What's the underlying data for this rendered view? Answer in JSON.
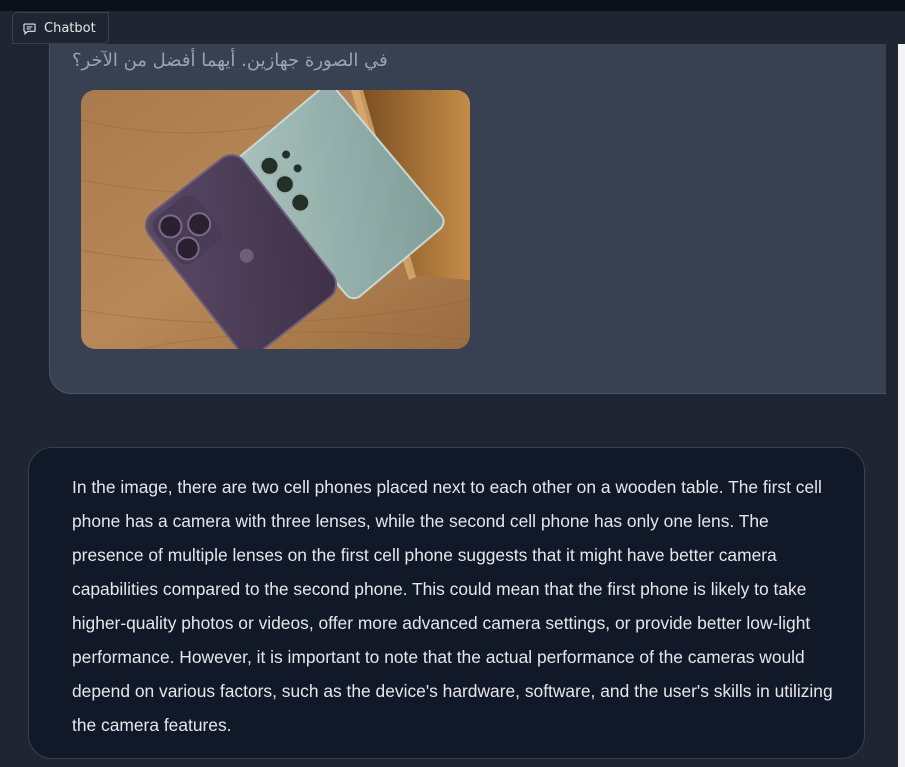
{
  "header": {
    "label": "Chatbot",
    "icon": "chat-bubble-icon"
  },
  "messages": [
    {
      "role": "user",
      "text": "في الصورة جهازين. أيهما أفضل من الآخر؟",
      "image": "two-smartphones-on-wooden-table"
    },
    {
      "role": "bot",
      "text": "In the image, there are two cell phones placed next to each other on a wooden table. The first cell phone has a camera with three lenses, while the second cell phone has only one lens. The presence of multiple lenses on the first cell phone suggests that it might have better camera capabilities compared to the second phone. This could mean that the first phone is likely to take higher-quality photos or videos, offer more advanced camera settings, or provide better low-light performance. However, it is important to note that the actual performance of the cameras would depend on various factors, such as the device's hardware, software, and the user's skills in utilizing the camera features."
    }
  ],
  "colors": {
    "background": "#1f2532",
    "user_bubble": "#374151",
    "bot_bubble": "#111827",
    "text": "#e5e7eb"
  }
}
